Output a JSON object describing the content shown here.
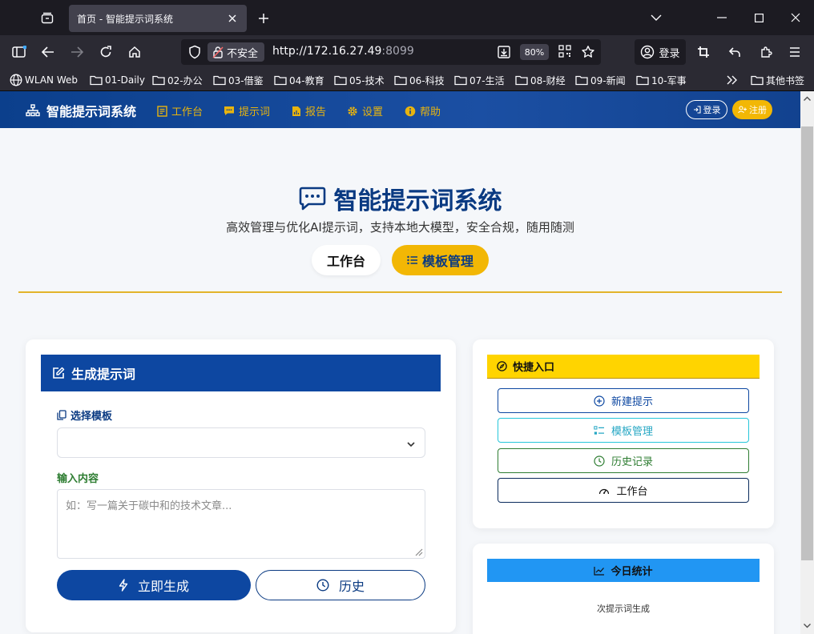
{
  "browser": {
    "tab_title": "首页 - 智能提示词系统",
    "security_label": "不安全",
    "url_main": "http://172.16.27.49",
    "url_port": ":8099",
    "zoom": "80%",
    "account_label": "登录",
    "bookmarks": [
      "WLAN Web",
      "01-Daily",
      "02-办公",
      "03-借鉴",
      "04-教育",
      "05-技术",
      "06-科技",
      "07-生活",
      "08-财经",
      "09-新闻",
      "10-军事"
    ],
    "other_bookmarks": "其他书签"
  },
  "site_nav": {
    "brand": "智能提示词系统",
    "links": [
      "工作台",
      "提示词",
      "报告",
      "设置",
      "帮助"
    ],
    "login": "登录",
    "register": "注册"
  },
  "hero": {
    "title": "智能提示词系统",
    "subtitle": "高效管理与优化AI提示词，支持本地大模型，安全合规，随用随测",
    "tab_workspace": "工作台",
    "tab_templates": "模板管理"
  },
  "generate": {
    "header": "生成提示词",
    "template_label": "选择模板",
    "template_value": "",
    "input_label": "输入内容",
    "input_placeholder": "如：写一篇关于碳中和的技术文章...",
    "generate_btn": "立即生成",
    "history_btn": "历史"
  },
  "quick": {
    "header": "快捷入口",
    "new": "新建提示",
    "templates": "模板管理",
    "history": "历史记录",
    "workspace": "工作台"
  },
  "stats": {
    "header": "今日统计",
    "text": "次提示词生成"
  },
  "colors": {
    "primary": "#0d47a1",
    "accent": "#f2b705",
    "quick_header": "#ffd400",
    "stats_header": "#2196f3"
  }
}
